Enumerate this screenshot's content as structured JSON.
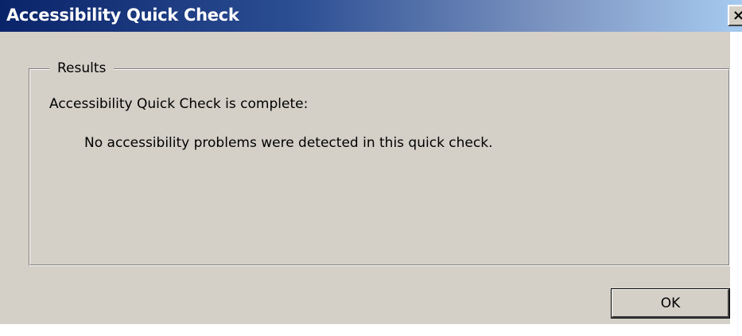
{
  "window": {
    "title": "Accessibility Quick Check",
    "close_icon": "close-icon",
    "close_glyph": "×",
    "titlebar_color_start": "#0a246a",
    "titlebar_color_end": "#a6caf0",
    "face_color": "#d4d0c8"
  },
  "results": {
    "legend": "Results",
    "status": "Accessibility Quick Check is complete:",
    "message": "No accessibility problems were detected in this quick check."
  },
  "buttons": {
    "ok_label": "OK"
  }
}
